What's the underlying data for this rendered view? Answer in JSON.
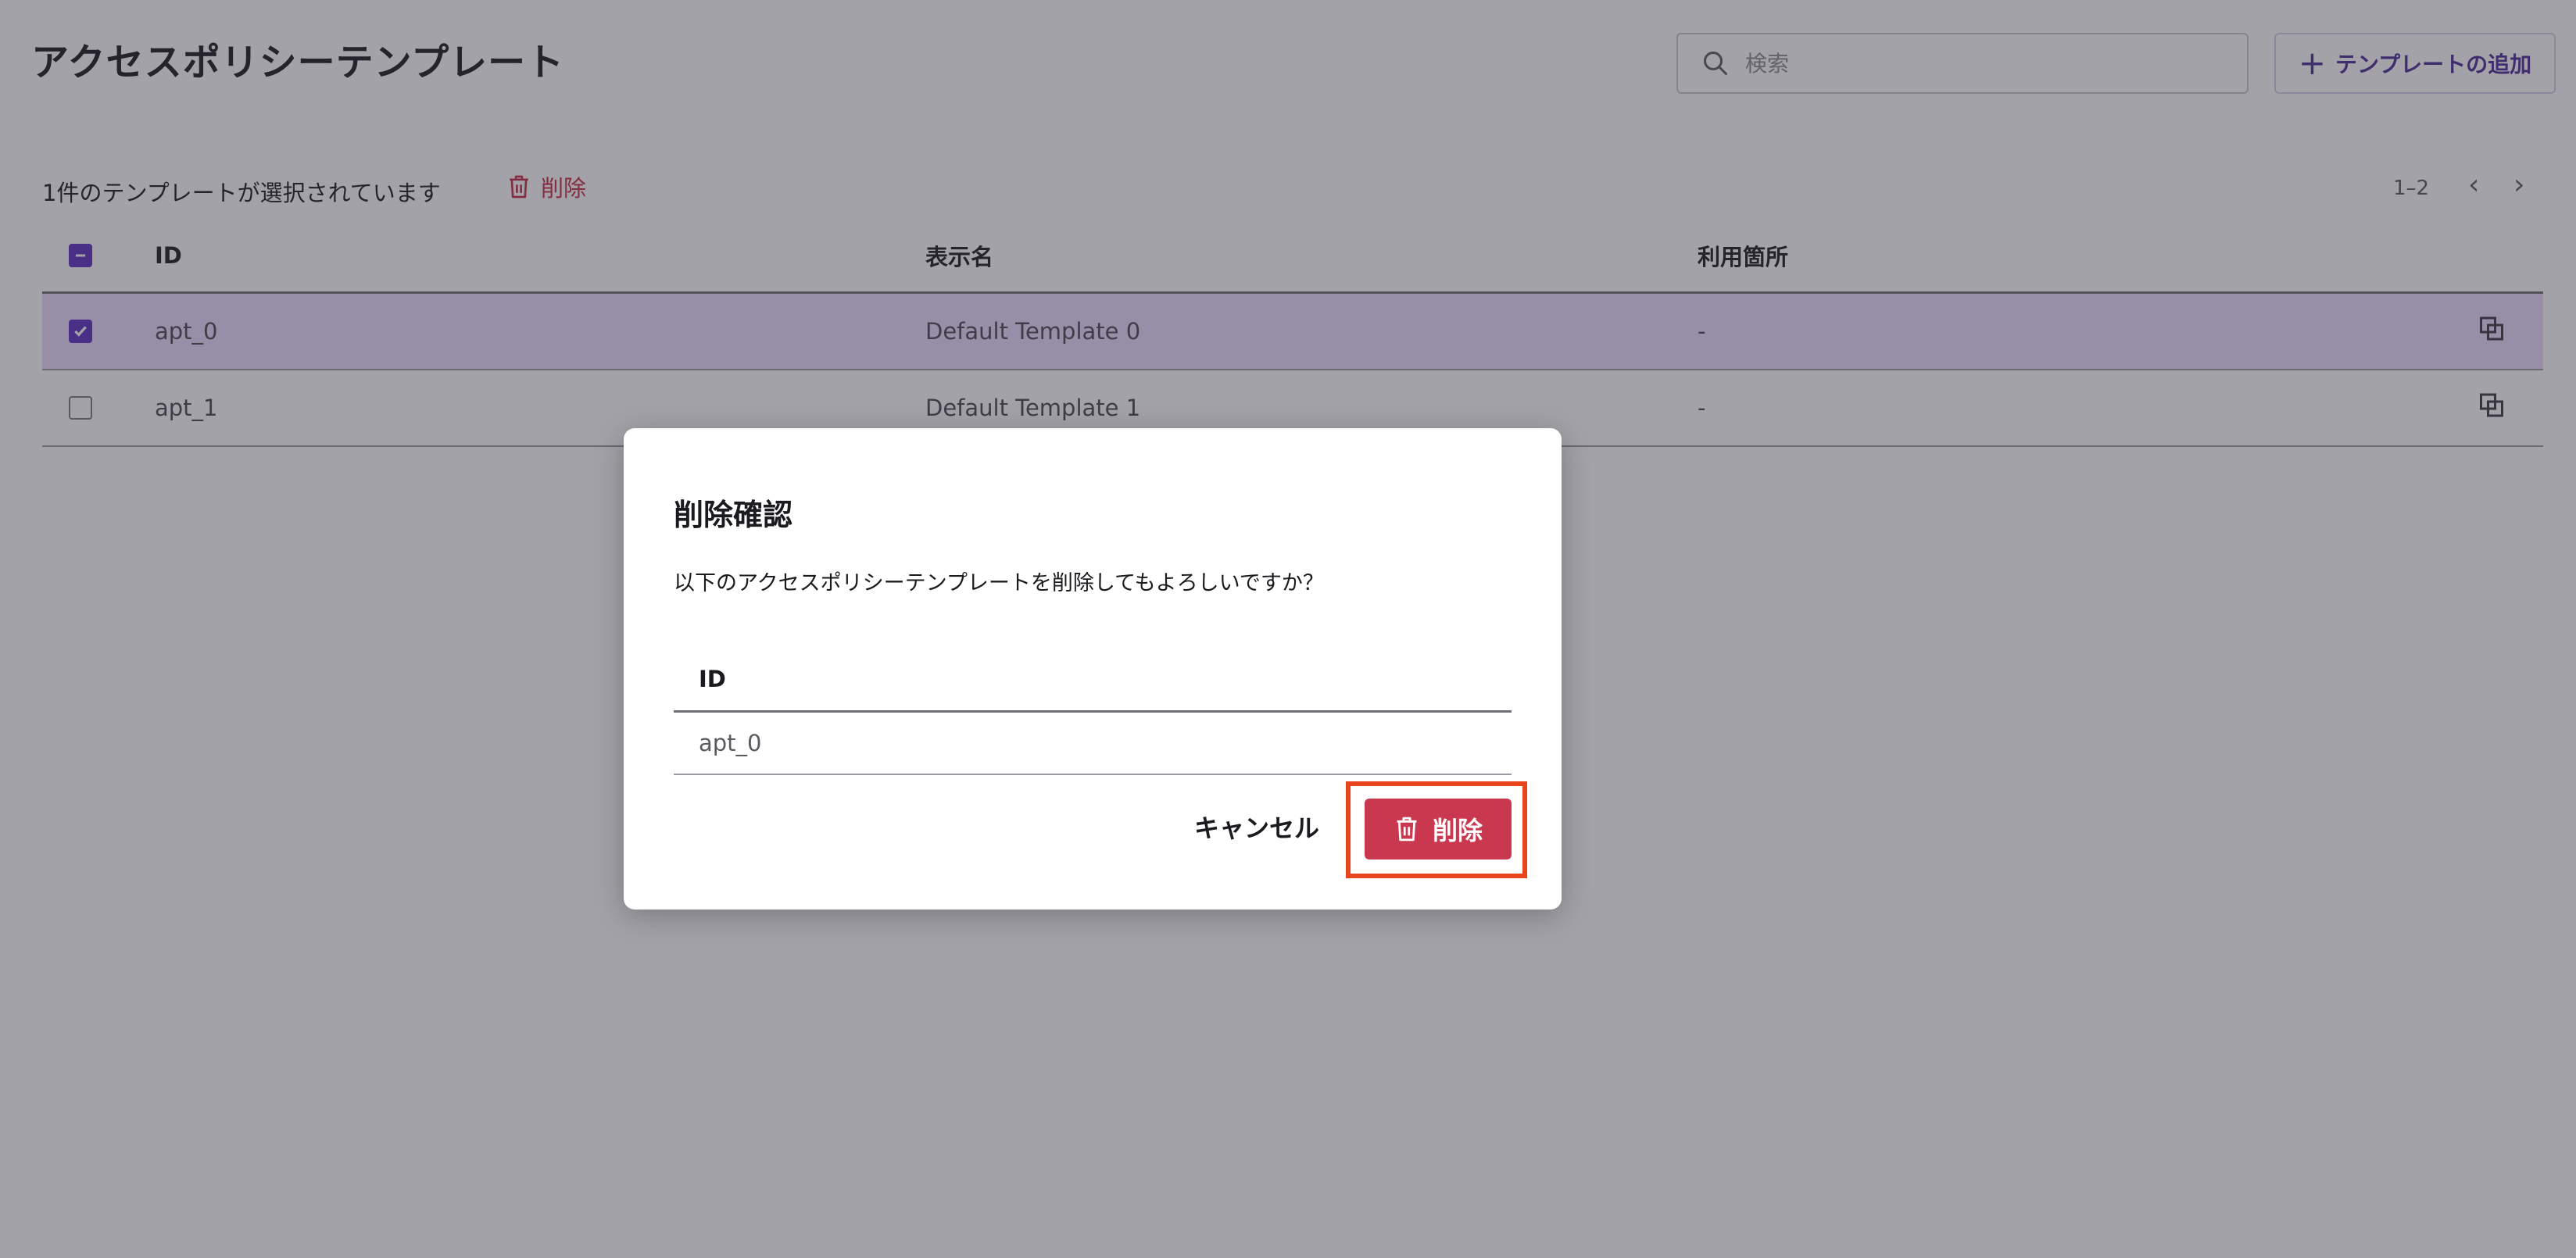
{
  "page": {
    "title": "アクセスポリシーテンプレート"
  },
  "search": {
    "placeholder": "検索",
    "icon": "search-icon"
  },
  "actions": {
    "add_label": "テンプレートの追加",
    "add_icon": "plus-icon"
  },
  "selection": {
    "text": "1件のテンプレートが選択されています",
    "delete_label": "削除"
  },
  "pager": {
    "range": "1–2",
    "prev_icon": "chevron-left-icon",
    "next_icon": "chevron-right-icon"
  },
  "table": {
    "headers": {
      "id": "ID",
      "name": "表示名",
      "usage": "利用箇所"
    },
    "rows": [
      {
        "id": "apt_0",
        "name": "Default Template 0",
        "usage": "-",
        "checked": true
      },
      {
        "id": "apt_1",
        "name": "Default Template 1",
        "usage": "-",
        "checked": false
      }
    ]
  },
  "dialog": {
    "title": "削除確認",
    "message": "以下のアクセスポリシーテンプレートを削除してもよろしいですか？",
    "table_header": "ID",
    "items": [
      "apt_0"
    ],
    "cancel_label": "キャンセル",
    "confirm_label": "削除"
  },
  "colors": {
    "accent": "#5b2fc2",
    "danger": "#c9384f",
    "highlight": "#e8451d",
    "selected_row": "#eadbff"
  }
}
